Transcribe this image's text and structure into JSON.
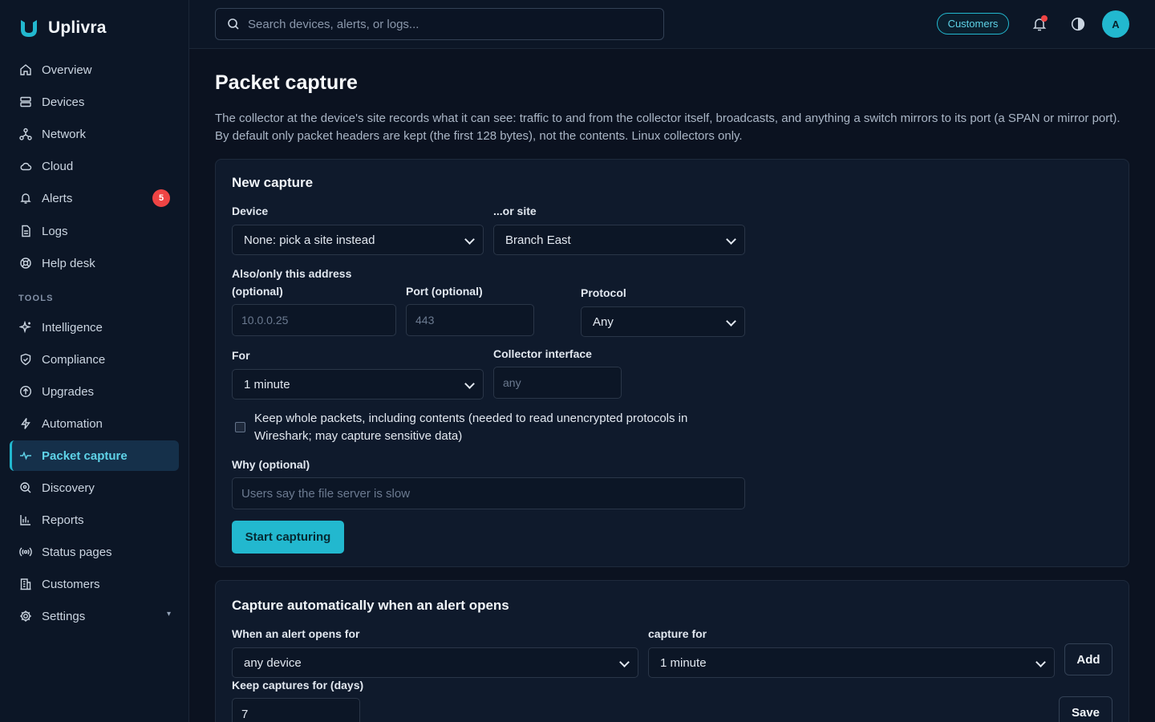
{
  "brand": {
    "name": "Uplivra"
  },
  "sidebar": {
    "items": [
      {
        "label": "Overview",
        "icon": "home-icon"
      },
      {
        "label": "Devices",
        "icon": "server-icon"
      },
      {
        "label": "Network",
        "icon": "network-icon"
      },
      {
        "label": "Cloud",
        "icon": "cloud-icon"
      },
      {
        "label": "Alerts",
        "icon": "bell-icon",
        "badge": "5"
      },
      {
        "label": "Logs",
        "icon": "document-icon"
      },
      {
        "label": "Help desk",
        "icon": "lifebuoy-icon"
      }
    ],
    "tools_label": "TOOLS",
    "tools": [
      {
        "label": "Intelligence",
        "icon": "sparkle-icon"
      },
      {
        "label": "Compliance",
        "icon": "shield-icon"
      },
      {
        "label": "Upgrades",
        "icon": "upgrade-icon"
      },
      {
        "label": "Automation",
        "icon": "bolt-icon"
      },
      {
        "label": "Packet capture",
        "icon": "pulse-icon",
        "active": true
      },
      {
        "label": "Discovery",
        "icon": "discovery-icon"
      },
      {
        "label": "Reports",
        "icon": "bar-chart-icon"
      },
      {
        "label": "Status pages",
        "icon": "broadcast-icon"
      },
      {
        "label": "Customers",
        "icon": "building-icon"
      },
      {
        "label": "Settings",
        "icon": "gear-icon",
        "caret": "▾"
      }
    ]
  },
  "topbar": {
    "search_placeholder": "Search devices, alerts, or logs...",
    "customers_pill": "Customers",
    "avatar_initial": "A"
  },
  "page": {
    "title": "Packet capture",
    "description": "The collector at the device's site records what it can see: traffic to and from the collector itself, broadcasts, and anything a switch mirrors to its port (a SPAN or mirror port). By default only packet headers are kept (the first 128 bytes), not the contents. Linux collectors only."
  },
  "new_capture": {
    "title": "New capture",
    "device_label": "Device",
    "device_value": "None: pick a site instead",
    "site_label": "...or site",
    "site_value": "Branch East",
    "address_label": "Also/only this address (optional)",
    "address_placeholder": "10.0.0.25",
    "port_label": "Port (optional)",
    "port_placeholder": "443",
    "protocol_label": "Protocol",
    "protocol_value": "Any",
    "for_label": "For",
    "for_value": "1 minute",
    "interface_label": "Collector interface",
    "interface_placeholder": "any",
    "whole_packets_label": "Keep whole packets, including contents (needed to read unencrypted protocols in Wireshark; may capture sensitive data)",
    "why_label": "Why (optional)",
    "why_placeholder": "Users say the file server is slow",
    "start_button": "Start capturing"
  },
  "auto_capture": {
    "title": "Capture automatically when an alert opens",
    "when_label": "When an alert opens for",
    "when_value": "any device",
    "capture_for_label": "capture for",
    "capture_for_value": "1 minute",
    "add_button": "Add",
    "keep_label": "Keep captures for (days)",
    "keep_value": "7",
    "save_button": "Save"
  },
  "colors": {
    "accent": "#22b8cf",
    "background": "#0b1220",
    "sidebar": "#0c1626",
    "badge": "#ef4444"
  }
}
